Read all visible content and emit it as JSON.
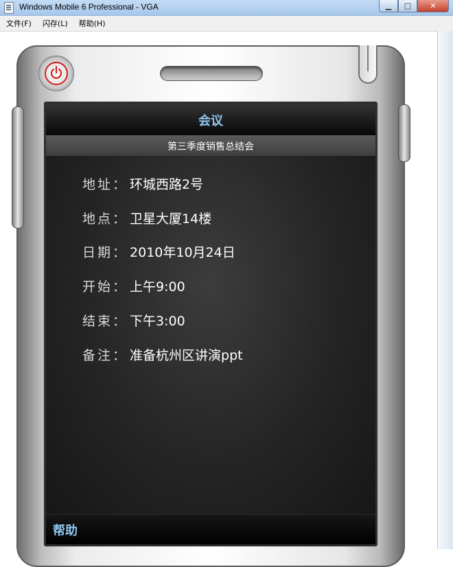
{
  "window": {
    "title": "Windows Mobile 6 Professional - VGA",
    "minimize_glyph": "▁",
    "maximize_glyph": "□",
    "close_glyph": "✕"
  },
  "menubar": {
    "items": [
      {
        "label": "文件(F)"
      },
      {
        "label": "闪存(L)"
      },
      {
        "label": "帮助(H)"
      }
    ]
  },
  "screen": {
    "title": "会议",
    "subtitle": "第三季度销售总结会",
    "fields": [
      {
        "label": "地址",
        "value": "环城西路2号"
      },
      {
        "label": "地点",
        "value": "卫星大厦14楼"
      },
      {
        "label": "日期",
        "value": "2010年10月24日"
      },
      {
        "label": "开始",
        "value": "上午9:00"
      },
      {
        "label": "结束",
        "value": "下午3:00"
      },
      {
        "label": "备注",
        "value": "准备杭州区讲演ppt"
      }
    ],
    "colon": "：",
    "softkey_left": "帮助"
  },
  "colors": {
    "title_accent": "#8fc7ef",
    "power_red": "#d11f1f"
  }
}
